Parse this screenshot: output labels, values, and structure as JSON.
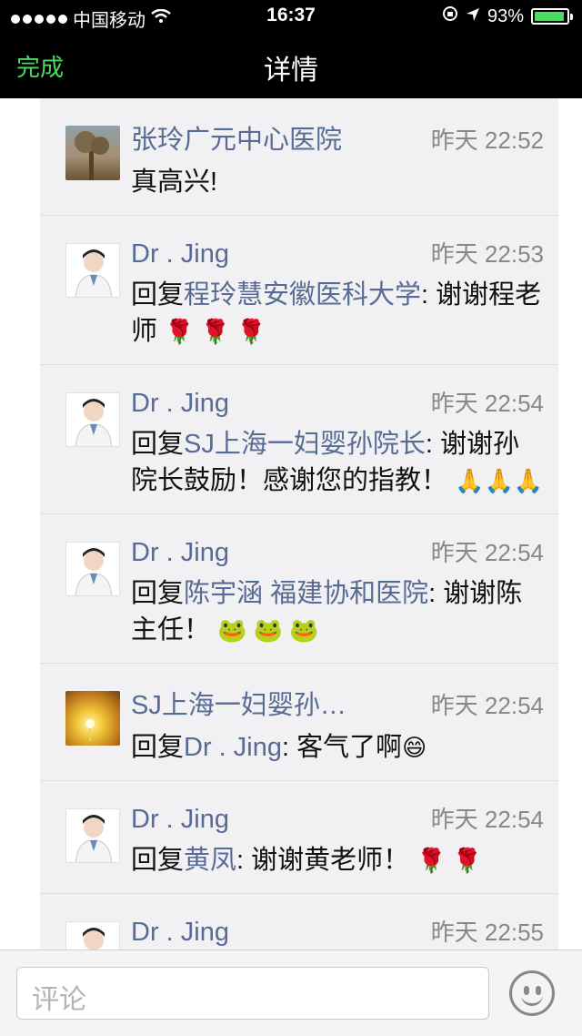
{
  "status_bar": {
    "carrier": "中国移动",
    "time": "16:37",
    "battery": "93%",
    "battery_level": 0.93
  },
  "nav": {
    "done": "完成",
    "title": "详情"
  },
  "comments": [
    {
      "name": "张玲广元中心医院",
      "time": "昨天 22:52",
      "text": "真高兴!",
      "avatar": "landscape-avatar"
    },
    {
      "name": "Dr . Jing",
      "time": "昨天 22:53",
      "prefix": "回复",
      "reply_to": "程玲慧安徽医科大学",
      "text": ": 谢谢程老师",
      "emoji": "🌹 🌹 🌹",
      "avatar": "doctor-avatar"
    },
    {
      "name": "Dr . Jing",
      "time": "昨天 22:54",
      "prefix": "回复",
      "reply_to": "SJ上海一妇婴孙院长",
      "text": ": 谢谢孙院长鼓励！感谢您的指教！",
      "emoji": "🙏🙏🙏",
      "avatar": "doctor-avatar"
    },
    {
      "name": "Dr . Jing",
      "time": "昨天 22:54",
      "prefix": "回复",
      "reply_to": "陈宇涵 福建协和医院",
      "text": ": 谢谢陈主任！",
      "emoji": "🐸 🐸 🐸",
      "avatar": "doctor-avatar"
    },
    {
      "name": "SJ上海一妇婴孙…",
      "time": "昨天 22:54",
      "prefix": "回复",
      "reply_to": "Dr . Jing",
      "text": ": 客气了啊",
      "emoji": "😄",
      "avatar": "sunflower-avatar"
    },
    {
      "name": "Dr . Jing",
      "time": "昨天 22:54",
      "prefix": "回复",
      "reply_to": "黄凤",
      "text": ": 谢谢黄老师！",
      "emoji": "🌹 🌹",
      "avatar": "doctor-avatar"
    },
    {
      "name": "Dr . Jing",
      "time": "昨天 22:55",
      "avatar": "doctor-avatar"
    }
  ],
  "comment_box": {
    "placeholder": "评论"
  },
  "colors": {
    "accent_green": "#4cd964",
    "link_blue": "#576b95"
  }
}
